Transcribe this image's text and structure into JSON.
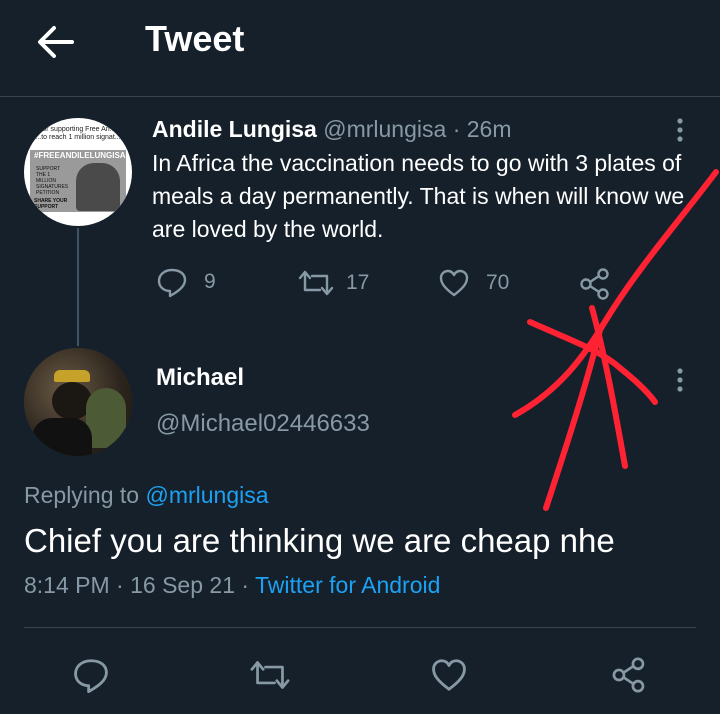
{
  "header": {
    "title": "Tweet"
  },
  "parent_tweet": {
    "author_name": "Andile Lungisa",
    "handle": "@mrlungisa",
    "time": "· 26m",
    "text": "In Africa the vaccination needs to go with 3 plates of meals a day permanently. That is when will know we are loved by the world.",
    "avatar_text": {
      "top": "for supporting Free An...",
      "sub": "...to reach 1 million signat...",
      "hashtag": "#FREEANDILELUNGISA",
      "box": "SUPPORT THE 1 MILLION SIGNATURES PETITION",
      "badge": "SHARE YOUR SUPPORT"
    },
    "stats": {
      "replies": "9",
      "retweets": "17",
      "likes": "70"
    }
  },
  "reply_tweet": {
    "author_name": "Michael",
    "handle": "@Michael02446633",
    "replying_to_label": "Replying to",
    "replying_to_handle": "@mrlungisa",
    "text": "Chief you are thinking we are cheap nhe",
    "time": "8:14 PM",
    "date": "16 Sep 21",
    "source": "Twitter for Android",
    "separator": "·"
  },
  "colors": {
    "background": "#15202b",
    "muted": "#8899a6",
    "accent": "#1da1f2",
    "annotation": "#ff2233"
  },
  "icons": [
    "back-arrow-icon",
    "more-icon",
    "reply-icon",
    "retweet-icon",
    "like-icon",
    "share-icon"
  ]
}
